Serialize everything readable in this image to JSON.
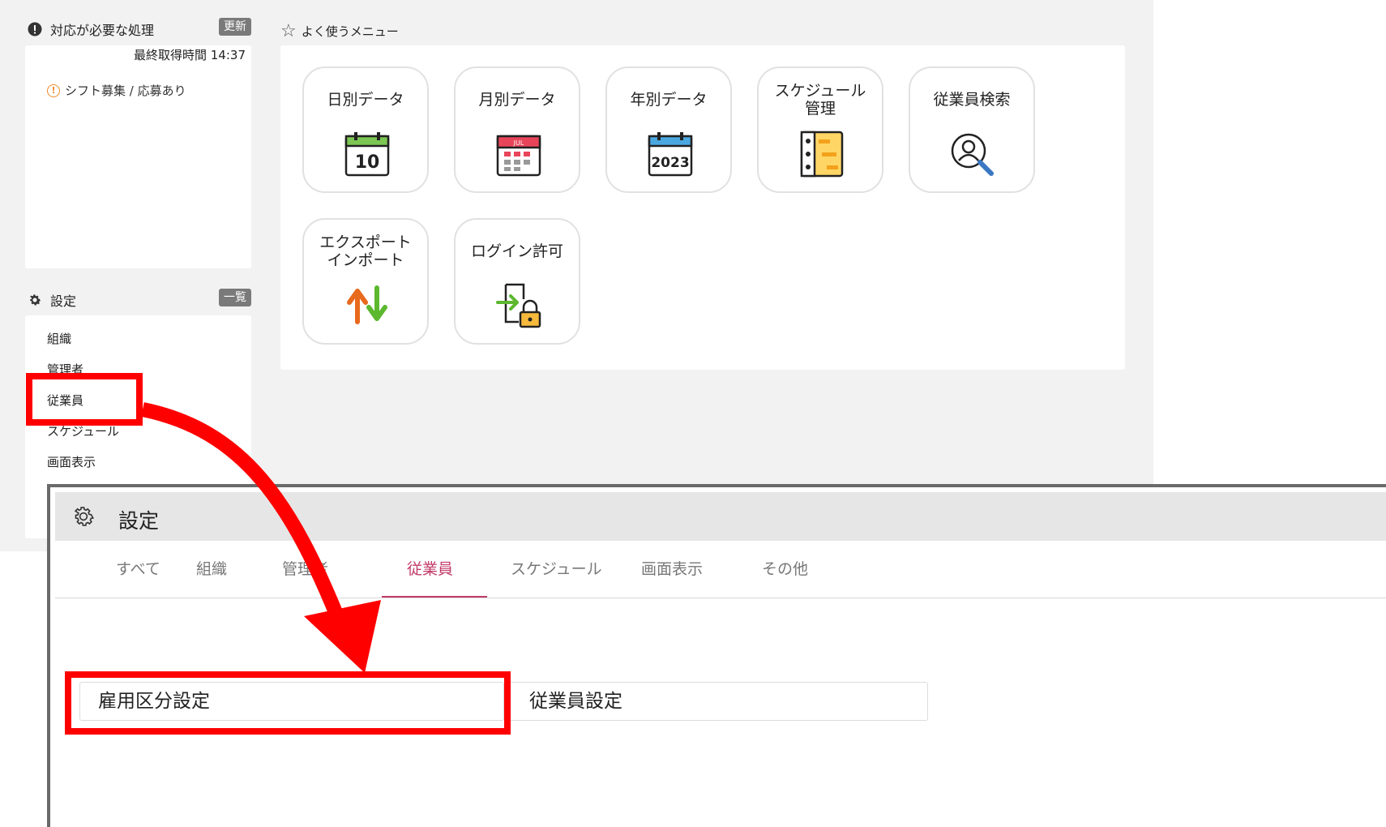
{
  "alerts_section": {
    "title": "対応が必要な処理",
    "refresh_label": "更新",
    "last_fetch": "最終取得時間 14:37",
    "items": [
      "シフト募集 / 応募あり"
    ]
  },
  "settings_section": {
    "title": "設定",
    "list_label": "一覧",
    "items": [
      "組織",
      "管理者",
      "従業員",
      "スケジュール",
      "画面表示"
    ]
  },
  "favorites": {
    "title": "よく使うメニュー",
    "tiles": [
      {
        "label": "日別データ",
        "icon": "calendar-day-icon",
        "icon_text": "10"
      },
      {
        "label": "月別データ",
        "icon": "calendar-month-icon",
        "icon_text": "JUL"
      },
      {
        "label": "年別データ",
        "icon": "calendar-year-icon",
        "icon_text": "2023"
      },
      {
        "label": "スケジュール\n管理",
        "icon": "schedule-chart-icon"
      },
      {
        "label": "従業員検索",
        "icon": "user-search-icon"
      },
      {
        "label": "エクスポート\nインポート",
        "icon": "export-import-arrows-icon"
      },
      {
        "label": "ログイン許可",
        "icon": "login-lock-icon"
      }
    ]
  },
  "settings_window": {
    "title": "設定",
    "tabs": [
      "すべて",
      "組織",
      "管理者",
      "従業員",
      "スケジュール",
      "画面表示",
      "その他"
    ],
    "active_tab": "従業員",
    "buttons": [
      "雇用区分設定",
      "従業員設定"
    ]
  },
  "colors": {
    "highlight": "#ff0000",
    "active_tab": "#c23b6a",
    "panel_bg": "#f2f2f2"
  }
}
